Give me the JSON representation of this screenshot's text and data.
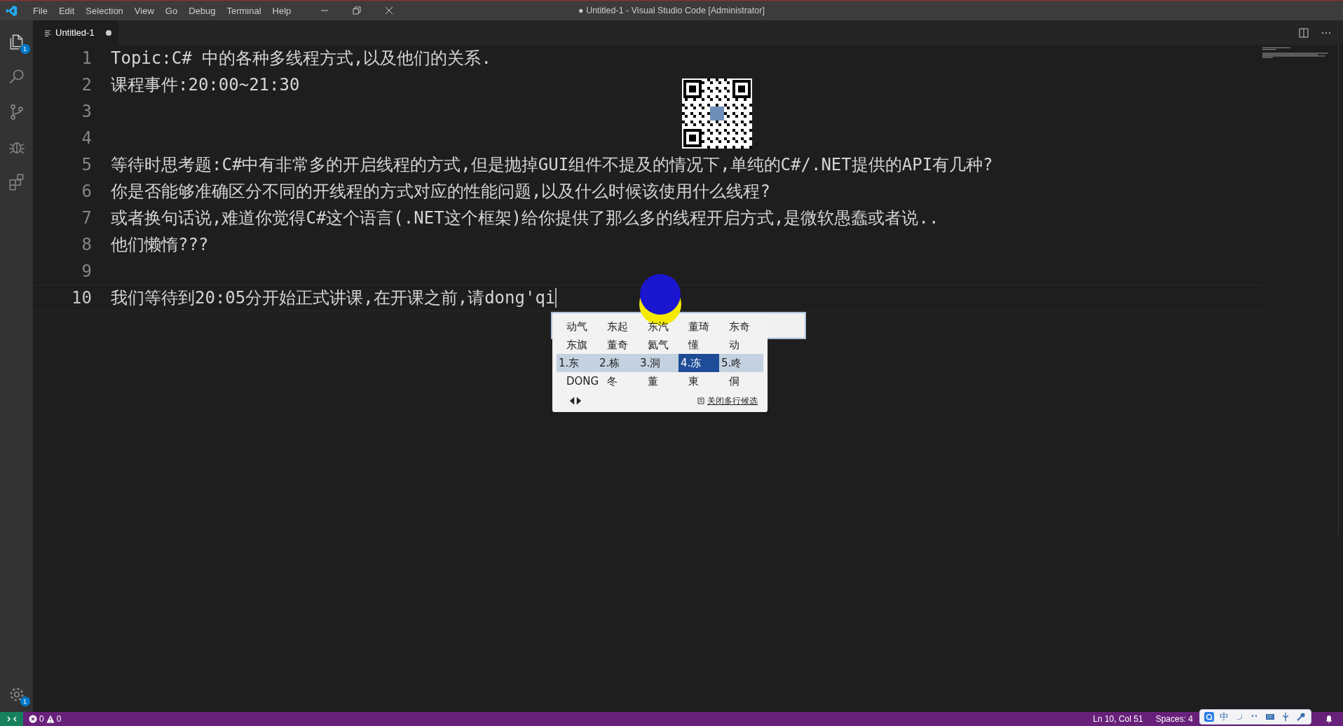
{
  "window": {
    "title": "● Untitled-1 - Visual Studio Code [Administrator]"
  },
  "menu": [
    "File",
    "Edit",
    "Selection",
    "View",
    "Go",
    "Debug",
    "Terminal",
    "Help"
  ],
  "activity_bar": {
    "explorer_badge": "1",
    "settings_badge": "1"
  },
  "tab": {
    "label": "Untitled-1",
    "dirty": true
  },
  "lines": [
    {
      "number": "1",
      "text": "Topic:C# 中的各种多线程方式,以及他们的关系.",
      "current": false
    },
    {
      "number": "2",
      "text": "课程事件:20:00~21:30",
      "current": false
    },
    {
      "number": "3",
      "current": false
    },
    {
      "number": "4",
      "current": false
    },
    {
      "number": "5",
      "text": "等待时思考题:C#中有非常多的开启线程的方式,但是抛掉GUI组件不提及的情况下,单纯的C#/.NET提供的API有几种?",
      "current": false
    },
    {
      "number": "6",
      "text": "你是否能够准确区分不同的开线程的方式对应的性能问题,以及什么时候该使用什么线程?",
      "current": false
    },
    {
      "number": "7",
      "text": "或者换句话说,难道你觉得C#这个语言(.NET这个框架)给你提供了那么多的线程开启方式,是微软愚蠢或者说..",
      "current": false
    },
    {
      "number": "8",
      "text": "他们懒惰???",
      "current": false
    },
    {
      "number": "9",
      "current": false
    },
    {
      "number": "10",
      "text": "我们等待到20:05分开始正式讲课,在开课之前,请dong'qi",
      "current": true
    }
  ],
  "ime": {
    "rows": [
      {
        "highlighted": false,
        "items": [
          {
            "label": "动气",
            "selected": false
          },
          {
            "label": "东起",
            "selected": false
          },
          {
            "label": "东汽",
            "selected": false
          },
          {
            "label": "董琦",
            "selected": false
          },
          {
            "label": "东奇",
            "selected": false
          }
        ]
      },
      {
        "highlighted": false,
        "items": [
          {
            "label": "东旗",
            "selected": false
          },
          {
            "label": "董奇",
            "selected": false
          },
          {
            "label": "氦气",
            "selected": false
          },
          {
            "label": "懂",
            "selected": false
          },
          {
            "label": "动",
            "selected": false
          }
        ]
      },
      {
        "highlighted": true,
        "items": [
          {
            "label": "1.东",
            "selected": false
          },
          {
            "label": "2.栋",
            "selected": false
          },
          {
            "label": "3.洞",
            "selected": false
          },
          {
            "label": "4.冻",
            "selected": true
          },
          {
            "label": "5.咚",
            "selected": false
          }
        ]
      },
      {
        "highlighted": false,
        "items": [
          {
            "label": "DONG",
            "selected": false
          },
          {
            "label": "冬",
            "selected": false
          },
          {
            "label": "董",
            "selected": false
          },
          {
            "label": "東",
            "selected": false
          },
          {
            "label": "侗",
            "selected": false
          }
        ]
      }
    ],
    "close_multiline": "关闭多行候选",
    "mode": "中"
  },
  "status_bar": {
    "errors": "0",
    "warnings": "0",
    "position": "Ln 10, Col 51",
    "indentation": "Spaces: 4"
  }
}
